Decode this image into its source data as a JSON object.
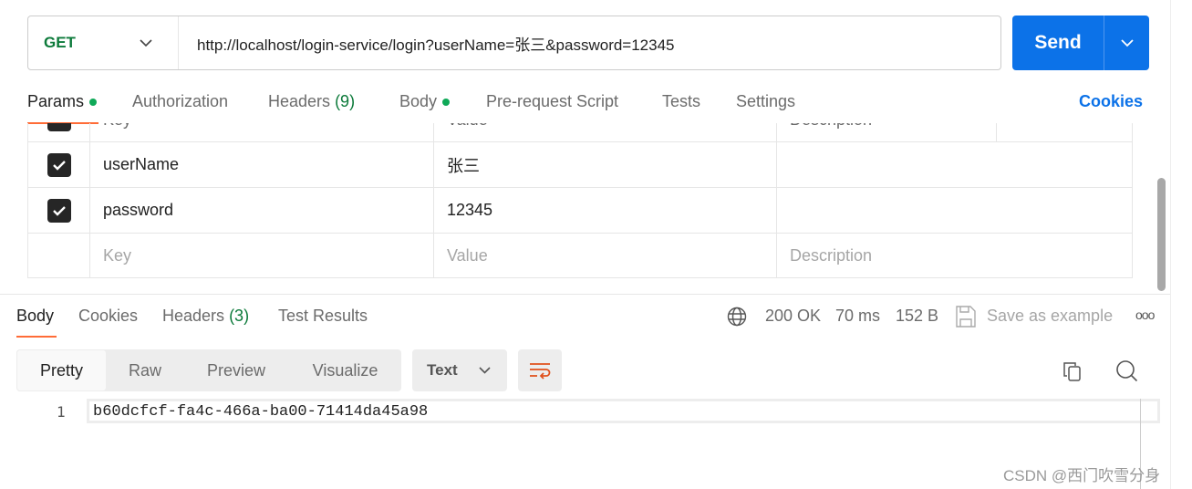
{
  "request": {
    "method": "GET",
    "url": "http://localhost/login-service/login?userName=张三&password=12345",
    "send_label": "Send"
  },
  "req_tabs": {
    "params": "Params",
    "authorization": "Authorization",
    "headers": "Headers",
    "headers_count": "(9)",
    "body": "Body",
    "prerequest": "Pre-request Script",
    "tests": "Tests",
    "settings": "Settings",
    "cookies": "Cookies"
  },
  "params": {
    "headers": {
      "key": "Key",
      "value": "Value",
      "description": "Description"
    },
    "rows": [
      {
        "checked": true,
        "key": "userName",
        "value": "张三"
      },
      {
        "checked": true,
        "key": "password",
        "value": "12345"
      }
    ],
    "placeholder": {
      "key": "Key",
      "value": "Value",
      "description": "Description"
    }
  },
  "resp_tabs": {
    "body": "Body",
    "cookies": "Cookies",
    "headers": "Headers",
    "headers_count": "(3)",
    "test_results": "Test Results"
  },
  "status": {
    "code": "200 OK",
    "time": "70 ms",
    "size": "152 B",
    "save": "Save as example"
  },
  "view": {
    "pretty": "Pretty",
    "raw": "Raw",
    "preview": "Preview",
    "visualize": "Visualize",
    "format": "Text"
  },
  "body_lines": [
    {
      "n": "1",
      "text": "b60dcfcf-fa4c-466a-ba00-71414da45a98"
    }
  ],
  "watermark": "CSDN @西门吹雪分身",
  "colors": {
    "accent": "#0c72e8",
    "success": "#0c7a3a",
    "active_tab": "#ff6c37"
  }
}
